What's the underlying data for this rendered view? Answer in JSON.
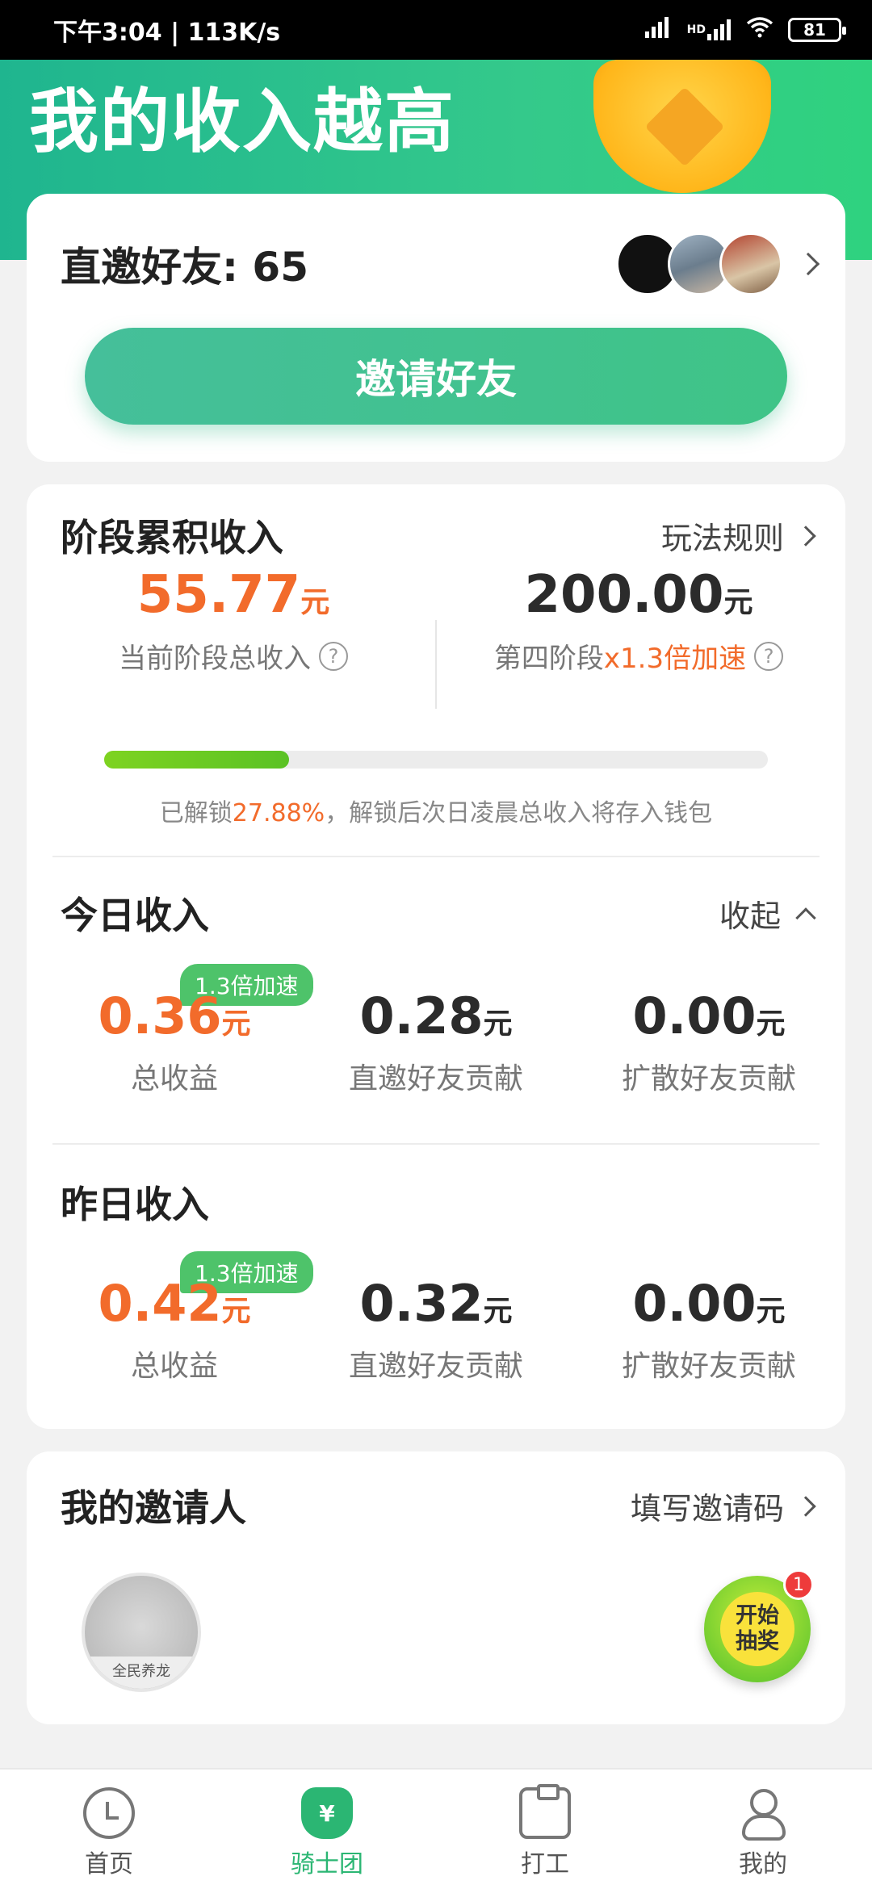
{
  "status_bar": {
    "time_speed": "下午3:04 | 113K/s",
    "network": "HD",
    "battery": "81"
  },
  "header": {
    "title": "我的收入越高"
  },
  "invite_card": {
    "friends_label": "直邀好友: 65",
    "invite_button": "邀请好友"
  },
  "stage_income": {
    "title": "阶段累积收入",
    "rules_link": "玩法规则",
    "current_value": "55.77",
    "current_unit": "元",
    "current_label": "当前阶段总收入",
    "target_value": "200.00",
    "target_unit": "元",
    "target_label_prefix": "第四阶段",
    "target_label_highlight": "x1.3倍加速",
    "help_glyph": "?",
    "progress_percent": 27.88,
    "unlock_prefix": "已解锁",
    "unlock_percent": "27.88%",
    "unlock_suffix": "，解锁后次日凌晨总收入将存入钱包"
  },
  "today_income": {
    "title": "今日收入",
    "collapse_link": "收起",
    "badge": "1.3倍加速",
    "total_value": "0.36",
    "total_label": "总收益",
    "direct_value": "0.28",
    "direct_label": "直邀好友贡献",
    "spread_value": "0.00",
    "spread_label": "扩散好友贡献",
    "unit": "元"
  },
  "yesterday_income": {
    "title": "昨日收入",
    "badge": "1.3倍加速",
    "total_value": "0.42",
    "total_label": "总收益",
    "direct_value": "0.32",
    "direct_label": "直邀好友贡献",
    "spread_value": "0.00",
    "spread_label": "扩散好友贡献",
    "unit": "元"
  },
  "inviter": {
    "title": "我的邀请人",
    "fill_code_link": "填写邀请码",
    "avatar_caption": "全民养龙",
    "lottery_line1": "开始",
    "lottery_line2": "抽奖",
    "lottery_badge": "1"
  },
  "bottom_nav": {
    "items": [
      {
        "label": "首页",
        "icon": "home-icon"
      },
      {
        "label": "骑士团",
        "icon": "money-bag-icon",
        "glyph": "¥"
      },
      {
        "label": "打工",
        "icon": "clipboard-icon"
      },
      {
        "label": "我的",
        "icon": "user-icon"
      }
    ]
  },
  "colors": {
    "brand_green": "#2bb673",
    "accent_orange": "#f26b2b",
    "progress_green": "#7ed321"
  }
}
